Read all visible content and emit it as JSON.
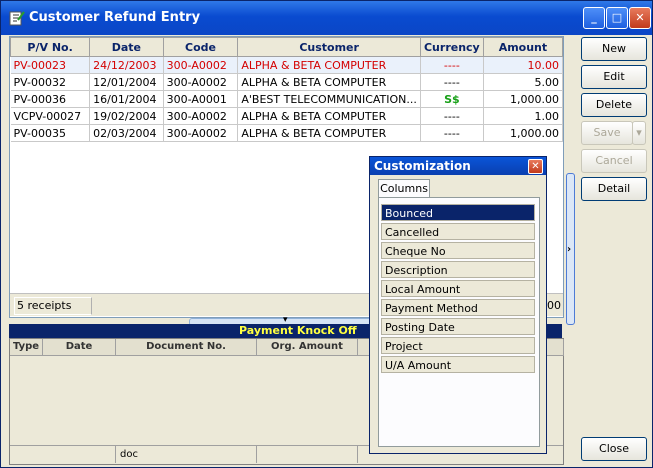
{
  "window": {
    "title": "Customer Refund Entry"
  },
  "grid": {
    "columns": [
      "P/V No.",
      "Date",
      "Code",
      "Customer",
      "Currency",
      "Amount"
    ],
    "rows": [
      {
        "pv": "PV-00023",
        "date": "24/12/2003",
        "code": "300-A0002",
        "customer": "ALPHA & BETA COMPUTER",
        "currency": "----",
        "amount": "10.00"
      },
      {
        "pv": "PV-00032",
        "date": "12/01/2004",
        "code": "300-A0002",
        "customer": "ALPHA & BETA COMPUTER",
        "currency": "----",
        "amount": "5.00"
      },
      {
        "pv": "PV-00036",
        "date": "16/01/2004",
        "code": "300-A0001",
        "customer": "A'BEST TELECOMMUNICATION...",
        "currency": "S$",
        "amount": "1,000.00"
      },
      {
        "pv": "VCPV-00027",
        "date": "19/02/2004",
        "code": "300-A0002",
        "customer": "ALPHA & BETA COMPUTER",
        "currency": "----",
        "amount": "1.00"
      },
      {
        "pv": "PV-00035",
        "date": "02/03/2004",
        "code": "300-A0002",
        "customer": "ALPHA & BETA COMPUTER",
        "currency": "----",
        "amount": "1,000.00"
      }
    ],
    "footer_count": "5 receipts",
    "footer_amount": ".00"
  },
  "knockoff": {
    "title": "Payment Knock Off",
    "columns": [
      "Type",
      "Date",
      "Document No.",
      "Org. Amount"
    ],
    "footer_doc": "doc"
  },
  "buttons": {
    "new": "New",
    "edit": "Edit",
    "delete": "Delete",
    "save": "Save",
    "cancel": "Cancel",
    "detail": "Detail",
    "close": "Close"
  },
  "customization": {
    "title": "Customization",
    "tab": "Columns",
    "items": [
      "Bounced",
      "Cancelled",
      "Cheque No",
      "Description",
      "Local Amount",
      "Payment Method",
      "Posting Date",
      "Project",
      "U/A Amount"
    ]
  },
  "colors": {
    "selected_row_text": "#d40000",
    "currency_green": "#18a018",
    "knockoff_title": "#ffff40"
  }
}
